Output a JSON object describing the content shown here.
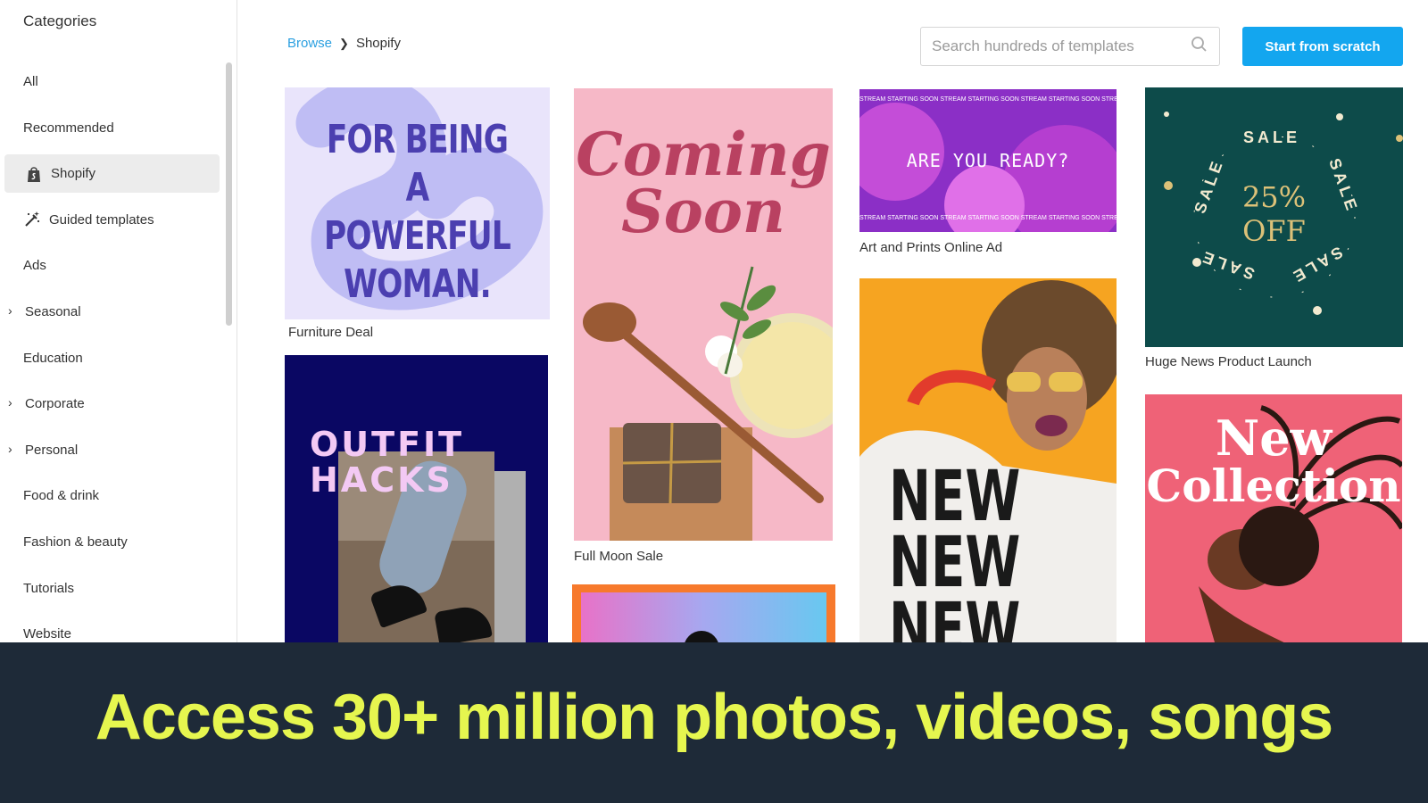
{
  "sidebar": {
    "title": "Categories",
    "items": [
      {
        "label": "All"
      },
      {
        "label": "Recommended"
      },
      {
        "label": "Shopify"
      },
      {
        "label": "Guided templates"
      },
      {
        "label": "Ads"
      },
      {
        "label": "Seasonal"
      },
      {
        "label": "Education"
      },
      {
        "label": "Corporate"
      },
      {
        "label": "Personal"
      },
      {
        "label": "Food & drink"
      },
      {
        "label": "Fashion & beauty"
      },
      {
        "label": "Tutorials"
      },
      {
        "label": "Website"
      }
    ]
  },
  "breadcrumb": {
    "root": "Browse",
    "current": "Shopify"
  },
  "search": {
    "placeholder": "Search hundreds of templates"
  },
  "actions": {
    "start_label": "Start from scratch"
  },
  "templates": {
    "powerful": {
      "line1": "FOR BEING",
      "line2": "A POWERFUL",
      "line3": "WOMAN.",
      "label": "Furniture Deal"
    },
    "outfit": {
      "line1": "OUTFIT",
      "line2": "HACKS"
    },
    "coming": {
      "line1": "Coming",
      "line2": "Soon",
      "label": "Full Moon Sale"
    },
    "ready": {
      "title": "ARE YOU READY?",
      "ticker": "STREAM STARTING SOON  STREAM STARTING SOON  STREAM STARTING SOON  STREAM STARTING SOON",
      "label": "Art and Prints Online Ad"
    },
    "newnew": {
      "line1": "NEW",
      "line2": "NEW",
      "line3": "NEW"
    },
    "sale": {
      "ring": "SALE",
      "line1": "25%",
      "line2": "OFF",
      "label": "Huge News Product Launch"
    },
    "collection": {
      "line1": "New",
      "line2": "Collection"
    }
  },
  "banner": {
    "text": "Access 30+ million photos, videos, songs"
  }
}
